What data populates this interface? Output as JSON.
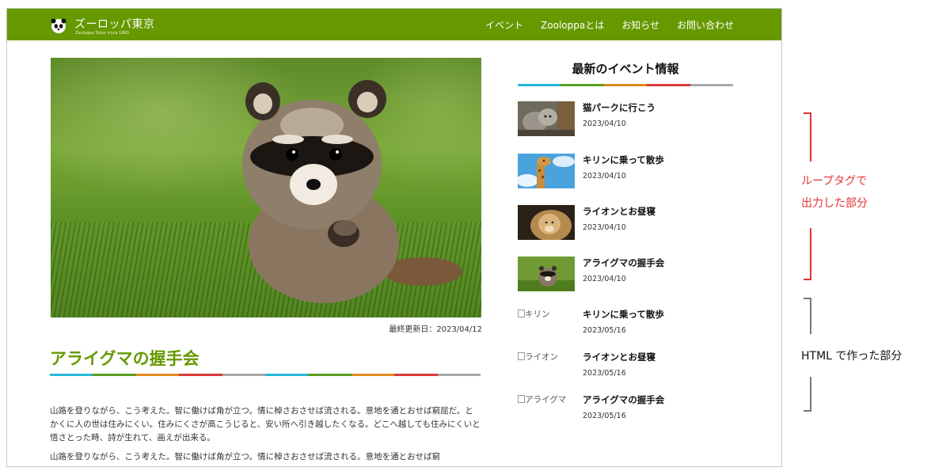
{
  "header": {
    "site_title": "ズーロッパ東京",
    "site_subtitle": "Zooloppa Tokyo since 1969",
    "nav": [
      "イベント",
      "Zooloppaとは",
      "お知らせ",
      "お問い合わせ"
    ],
    "brand_color": "#669900"
  },
  "main": {
    "hero_alt": "raccoon",
    "updated": "最終更新日：2023/04/12",
    "title": "アライグマの握手会",
    "paragraph1": "山路を登りながら、こう考えた。智に働けば角が立つ。情に棹さおさせば流される。意地を通とおせば窮屈だ。とかくに人の世は住みにくい。住みにくさが高こうじると、安い所へ引き越したくなる。どこへ越しても住みにくいと悟さとった時、詩が生れて、画えが出来る。",
    "paragraph2": "山路を登りながら、こう考えた。智に働けば角が立つ。情に棹さおさせば流される。意地を通とおせば窮"
  },
  "accent_colors": [
    "#29b6d8",
    "#5a9e1e",
    "#e08a1e",
    "#d93a3a",
    "#a8a8a8"
  ],
  "sidebar": {
    "title": "最新のイベント情報",
    "events": [
      {
        "title": "猫パークに行こう",
        "date": "2023/04/10",
        "thumb": "cat-photo-icon"
      },
      {
        "title": "キリンに乗って散歩",
        "date": "2023/04/10",
        "thumb": "giraffe-photo-icon"
      },
      {
        "title": "ライオンとお昼寝",
        "date": "2023/04/10",
        "thumb": "lion-photo-icon"
      },
      {
        "title": "アライグマの握手会",
        "date": "2023/04/10",
        "thumb": "raccoon-photo-icon"
      },
      {
        "title": "キリンに乗って散歩",
        "date": "2023/05/16",
        "alt": "キリン"
      },
      {
        "title": "ライオンとお昼寝",
        "date": "2023/05/16",
        "alt": "ライオン"
      },
      {
        "title": "アライグマの握手会",
        "date": "2023/05/16",
        "alt": "アライグマ"
      }
    ]
  },
  "annotations": {
    "loop_line1": "ループタグで",
    "loop_line2": "出力した部分",
    "html_label": "HTML で作った部分"
  }
}
